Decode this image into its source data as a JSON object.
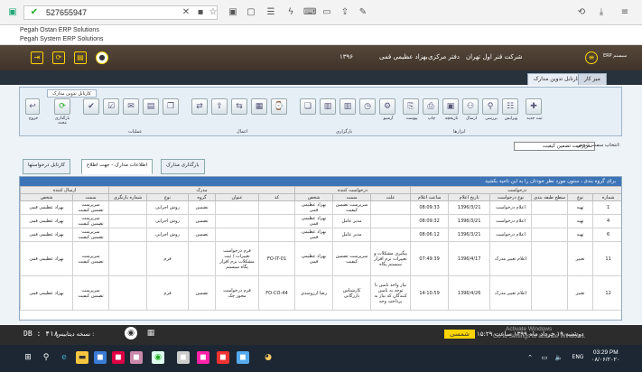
{
  "browser": {
    "address": "527655947",
    "bookmark_line1": "Pegah Ostan ERP Solutions",
    "bookmark_line2": "Pegah System ERP Solutions"
  },
  "header": {
    "company": "شرکت قنر اول تهران",
    "office": "دفتر مرکزی",
    "user": "بهزاد عظیمی قمی",
    "year": "۱۳۹۶",
    "system": "سیستم ERP"
  },
  "tabs": {
    "tab1": "کارتابل تدوین مدارک",
    "tab2": "میز کار"
  },
  "ribbon": {
    "tab": "کارتابل تدوین مدارک",
    "btn_exit": "خروج",
    "btn_reload": "بارگذاری مجدد",
    "group_actions": "عملیات",
    "group_access": "اعمال",
    "group_reports": "بارگزاری",
    "group_tools": "ابزارها",
    "lbl_new": "ثبت جدید",
    "lbl_edit": "ویرایش",
    "lbl_review": "بررسی",
    "lbl_archive": "آرشیو",
    "lbl_attach": "پیوست",
    "lbl_history": "تاریخچه",
    "lbl_print": "چاپ",
    "lbl_send": "ارسال"
  },
  "filter": {
    "label": "انتخاب سمت شخص:",
    "value": "سرپرست تضمین کیفیت"
  },
  "inner_tabs": {
    "t1": "بارگذاری مدارک",
    "t2": "اطلاعات مدارک - جهت اطلاع",
    "t3": "کارتابل درخواستها"
  },
  "grid": {
    "hint": "برای گروه بندی ، ستون مورد نظر خودتان را به این ناحیه بکشید",
    "group_headers": [
      "درخواست",
      "درخواست کننده",
      "مدرک",
      "ارسال کننده"
    ],
    "columns": [
      "شماره",
      "نوع",
      "سطح طبقه بندی",
      "نوع درخواست",
      "تاریخ اعلام",
      "ساعت اعلام",
      "علت",
      "سمت",
      "شخص",
      "کد",
      "عنوان",
      "گروه",
      "نوع",
      "شماره بازنگری",
      "سمت",
      "شخص"
    ],
    "rows": [
      {
        "num": "1",
        "type": "تهیه",
        "level": "",
        "reqtype": "اعلام درخواست",
        "date": "1396/3/21",
        "time": "08:09:33",
        "reason": "",
        "role": "سرپرست تضمین کیفیت",
        "person": "بهزاد عظیمی قمی",
        "code": "",
        "title": "",
        "group": "تضمین",
        "dtype": "روش اجرایی",
        "rev": "",
        "srole": "سرپرست تضمین کیفیت",
        "sperson": "بهزاد عظیمی قمی"
      },
      {
        "num": "4",
        "type": "تهیه",
        "level": "",
        "reqtype": "اعلام درخواست",
        "date": "1396/3/21",
        "time": "08:09:32",
        "reason": "",
        "role": "مدیر عامل",
        "person": "بهزاد عظیمی قمی",
        "code": "",
        "title": "",
        "group": "تضمین",
        "dtype": "روش اجرایی",
        "rev": "",
        "srole": "سرپرست تضمین کیفیت",
        "sperson": "بهزاد عظیمی قمی"
      },
      {
        "num": "6",
        "type": "تهیه",
        "level": "",
        "reqtype": "اعلام درخواست",
        "date": "1396/3/21",
        "time": "08:06:12",
        "reason": "",
        "role": "مدیر عامل",
        "person": "بهزاد عظیمی قمی",
        "code": "",
        "title": "",
        "group": "تضمین",
        "dtype": "روش اجرایی",
        "rev": "",
        "srole": "سرپرست تضمین کیفیت",
        "sperson": "بهزاد عظیمی قمی"
      },
      {
        "num": "11",
        "type": "تغییر",
        "level": "",
        "reqtype": "اعلام تغییر مدرک",
        "date": "1396/4/17",
        "time": "07:49:39",
        "reason": "پیگیری مشکلات و تغییرات نرم افزار سیستم پگاه",
        "role": "سرپرست تضمین کیفیت",
        "person": "بهزاد عظیمی قمی",
        "code": "FO-IT-01",
        "title": "فرم درخواست تغییرات / ثبت مشکلات نرم افزار پگاه سیستم",
        "group": "",
        "dtype": "فرم",
        "rev": "",
        "srole": "سرپرست تضمین کیفیت",
        "sperson": "بهزاد عظیمی قمی"
      },
      {
        "num": "12",
        "type": "تغییر",
        "level": "",
        "reqtype": "اعلام تغییر مدرک",
        "date": "1396/4/26",
        "time": "14:10:59",
        "reason": "نیاز واحد تامین با توجه به تامین کنندگان که نیاز به پرداخت وجه",
        "role": "کارشناس بازرگانی",
        "person": "رضا ازرومندی",
        "code": "FO-CO-44",
        "title": "فرم درخواست مجوز چک",
        "group": "تضمین",
        "dtype": "فرم",
        "rev": "",
        "srole": "سرپرست تضمین کیفیت",
        "sperson": "بهزاد عظیمی قمی"
      }
    ]
  },
  "status": {
    "db": "DB : ۴۱۸",
    "version": "نسخه دیتابیس :",
    "badge": "شمسی",
    "datetime": "دوشنبه ۱۹ خرداد ماه ۱۳۹۹ ساعت ۱۵:۲۹",
    "activate1": "Activate Windows",
    "activate2": "Go to Settings to activate Windows."
  },
  "taskbar": {
    "lang": "ENG",
    "time": "03:29 PM",
    "date": "۰۸/۰۶/۲۰۲۰"
  }
}
